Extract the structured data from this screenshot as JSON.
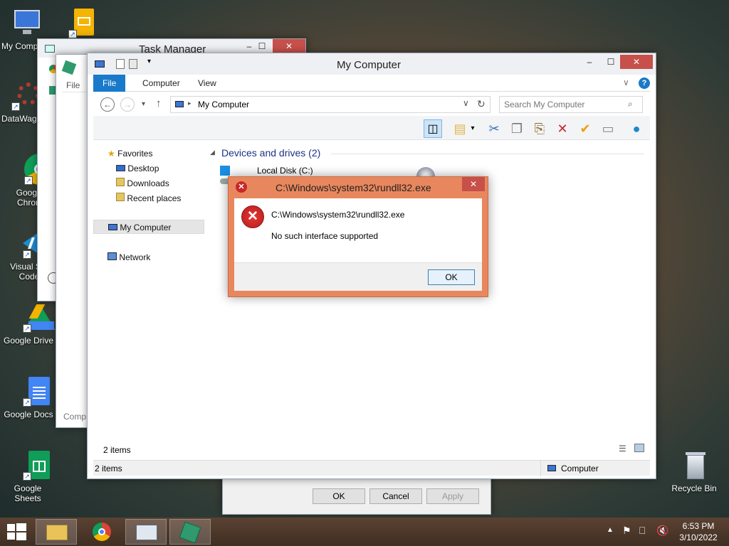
{
  "desktop": {
    "icons": [
      {
        "label": "My Comp",
        "icon": "computer-icon"
      },
      {
        "label": "DataWag",
        "icon": "gear-icon"
      },
      {
        "label": "Google Chrom",
        "icon": "chrome-icon"
      },
      {
        "label": "Visual Stu Code",
        "icon": "vscode-icon"
      },
      {
        "label": "Google Drive",
        "icon": "google-drive-icon"
      },
      {
        "label": "Google Docs",
        "icon": "google-docs-icon"
      },
      {
        "label": "Google Sheets",
        "icon": "google-sheets-icon"
      },
      {
        "label": "Recycle Bin",
        "icon": "recycle-bin-icon"
      }
    ]
  },
  "task_manager": {
    "title": "Task Manager"
  },
  "background_window": {
    "file_label": "File",
    "status_fragment": "Comp",
    "buttons": {
      "ok": "OK",
      "cancel": "Cancel",
      "apply": "Apply"
    }
  },
  "explorer": {
    "title": "My Computer",
    "tabs": [
      "File",
      "Computer",
      "View"
    ],
    "address": "My Computer",
    "search_placeholder": "Search My Computer",
    "nav": {
      "favorites": "Favorites",
      "desktop": "Desktop",
      "downloads": "Downloads",
      "recent": "Recent places",
      "my_computer": "My Computer",
      "network": "Network"
    },
    "group_header": "Devices and drives (2)",
    "drive_label": "Local Disk (C:)",
    "items_count": "2 items",
    "status_items": "2 items",
    "status_location": "Computer"
  },
  "dialog": {
    "title": "C:\\Windows\\system32\\rundll32.exe",
    "message_path": "C:\\Windows\\system32\\rundll32.exe",
    "message": "No such interface supported",
    "ok_label": "OK"
  },
  "taskbar": {
    "time": "6:53 PM",
    "date": "3/10/2022"
  },
  "colors": {
    "accent": "#1979ca",
    "dialog_border": "#e8875e",
    "close_red": "#c7504a",
    "error_red": "#c62828"
  }
}
